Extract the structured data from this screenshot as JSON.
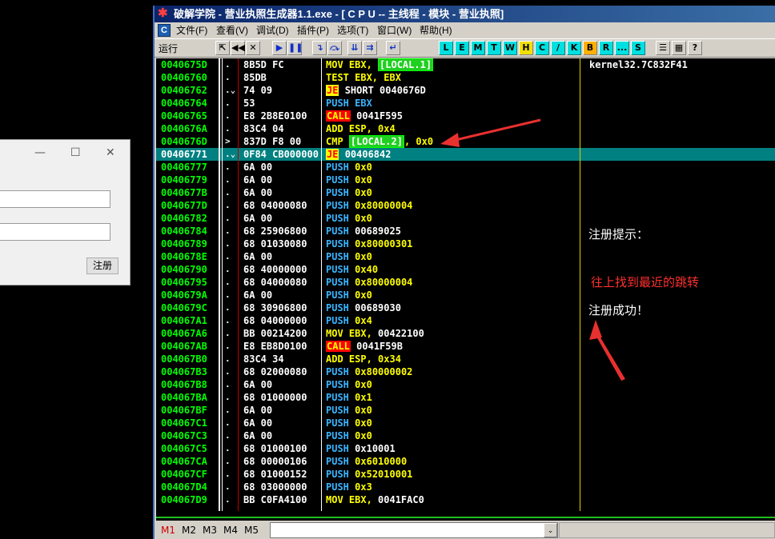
{
  "window": {
    "title": "破解学院 - 营业执照生成器1.1.exe - [ C P U -- 主线程 - 模块 - 营业执照]"
  },
  "menu": [
    "文件(F)",
    "查看(V)",
    "调试(D)",
    "插件(P)",
    "选项(T)",
    "窗口(W)",
    "帮助(H)"
  ],
  "toolbar": {
    "status": "运行",
    "letters": [
      "L",
      "E",
      "M",
      "T",
      "W",
      "H",
      "C",
      "/",
      "K",
      "B",
      "R",
      "...",
      "S"
    ]
  },
  "background_dialog": {
    "minimize": "—",
    "maximize": "☐",
    "close": "✕",
    "register_button": "注册"
  },
  "disasm": {
    "top_comment": "kernel32.7C832F41",
    "rows": [
      {
        "addr": "0040675D",
        "mark": ".",
        "hex": "8B5D FC",
        "mn": "MOV EBX,",
        "ops": [
          {
            "t": "LOCAL.1",
            "s": "grn"
          }
        ]
      },
      {
        "addr": "00406760",
        "mark": ".",
        "hex": "85DB",
        "mn": "TEST EBX, EBX",
        "ops": []
      },
      {
        "addr": "00406762",
        "mark": ".⌄",
        "hex": "74 09",
        "mn": "",
        "jmp": "JE",
        "ops": [
          {
            "t": "SHORT 0040676D",
            "s": "w"
          }
        ]
      },
      {
        "addr": "00406764",
        "mark": ".",
        "hex": "53",
        "mn": "PUSH EBX",
        "ops": []
      },
      {
        "addr": "00406765",
        "mark": ".",
        "hex": "E8 2B8E0100",
        "mn": "",
        "call": "CALL",
        "ops": [
          {
            "t": "0041F595",
            "s": "w"
          }
        ]
      },
      {
        "addr": "0040676A",
        "mark": ".",
        "hex": "83C4 04",
        "mn": "ADD ESP,",
        "ops": [
          {
            "t": "0x4",
            "s": "y"
          }
        ]
      },
      {
        "addr": "0040676D",
        "mark": ">",
        "hex": "837D F8 00",
        "mn": "CMP",
        "ops": [
          {
            "t": "LOCAL.2",
            "s": "grn"
          },
          {
            "t": ", 0x0",
            "s": "y"
          }
        ]
      },
      {
        "addr": "00406771",
        "mark": ".⌄",
        "hex": "0F84 CB000000",
        "mn": "",
        "jmp": "JE",
        "ops": [
          {
            "t": "00406842",
            "s": "w"
          }
        ],
        "selected": true
      },
      {
        "addr": "00406777",
        "mark": ".",
        "hex": "6A 00",
        "mn": "PUSH",
        "ops": [
          {
            "t": "0x0",
            "s": "y"
          }
        ]
      },
      {
        "addr": "00406779",
        "mark": ".",
        "hex": "6A 00",
        "mn": "PUSH",
        "ops": [
          {
            "t": "0x0",
            "s": "y"
          }
        ]
      },
      {
        "addr": "0040677B",
        "mark": ".",
        "hex": "6A 00",
        "mn": "PUSH",
        "ops": [
          {
            "t": "0x0",
            "s": "y"
          }
        ]
      },
      {
        "addr": "0040677D",
        "mark": ".",
        "hex": "68 04000080",
        "mn": "PUSH",
        "ops": [
          {
            "t": "0x80000004",
            "s": "y"
          }
        ]
      },
      {
        "addr": "00406782",
        "mark": ".",
        "hex": "6A 00",
        "mn": "PUSH",
        "ops": [
          {
            "t": "0x0",
            "s": "y"
          }
        ]
      },
      {
        "addr": "00406784",
        "mark": ".",
        "hex": "68 25906800",
        "mn": "PUSH",
        "ops": [
          {
            "t": "00689025",
            "s": "w"
          }
        ]
      },
      {
        "addr": "00406789",
        "mark": ".",
        "hex": "68 01030080",
        "mn": "PUSH",
        "ops": [
          {
            "t": "0x80000301",
            "s": "y"
          }
        ]
      },
      {
        "addr": "0040678E",
        "mark": ".",
        "hex": "6A 00",
        "mn": "PUSH",
        "ops": [
          {
            "t": "0x0",
            "s": "y"
          }
        ]
      },
      {
        "addr": "00406790",
        "mark": ".",
        "hex": "68 40000000",
        "mn": "PUSH",
        "ops": [
          {
            "t": "0x40",
            "s": "y"
          }
        ]
      },
      {
        "addr": "00406795",
        "mark": ".",
        "hex": "68 04000080",
        "mn": "PUSH",
        "ops": [
          {
            "t": "0x80000004",
            "s": "y"
          }
        ]
      },
      {
        "addr": "0040679A",
        "mark": ".",
        "hex": "6A 00",
        "mn": "PUSH",
        "ops": [
          {
            "t": "0x0",
            "s": "y"
          }
        ]
      },
      {
        "addr": "0040679C",
        "mark": ".",
        "hex": "68 30906800",
        "mn": "PUSH",
        "ops": [
          {
            "t": "00689030",
            "s": "w"
          }
        ]
      },
      {
        "addr": "004067A1",
        "mark": ".",
        "hex": "68 04000000",
        "mn": "PUSH",
        "ops": [
          {
            "t": "0x4",
            "s": "y"
          }
        ]
      },
      {
        "addr": "004067A6",
        "mark": ".",
        "hex": "BB 00214200",
        "mn": "MOV EBX,",
        "ops": [
          {
            "t": "00422100",
            "s": "w"
          }
        ]
      },
      {
        "addr": "004067AB",
        "mark": ".",
        "hex": "E8 EB8D0100",
        "mn": "",
        "call": "CALL",
        "ops": [
          {
            "t": "0041F59B",
            "s": "w"
          }
        ]
      },
      {
        "addr": "004067B0",
        "mark": ".",
        "hex": "83C4 34",
        "mn": "ADD ESP,",
        "ops": [
          {
            "t": "0x34",
            "s": "y"
          }
        ]
      },
      {
        "addr": "004067B3",
        "mark": ".",
        "hex": "68 02000080",
        "mn": "PUSH",
        "ops": [
          {
            "t": "0x80000002",
            "s": "y"
          }
        ]
      },
      {
        "addr": "004067B8",
        "mark": ".",
        "hex": "6A 00",
        "mn": "PUSH",
        "ops": [
          {
            "t": "0x0",
            "s": "y"
          }
        ]
      },
      {
        "addr": "004067BA",
        "mark": ".",
        "hex": "68 01000000",
        "mn": "PUSH",
        "ops": [
          {
            "t": "0x1",
            "s": "y"
          }
        ]
      },
      {
        "addr": "004067BF",
        "mark": ".",
        "hex": "6A 00",
        "mn": "PUSH",
        "ops": [
          {
            "t": "0x0",
            "s": "y"
          }
        ]
      },
      {
        "addr": "004067C1",
        "mark": ".",
        "hex": "6A 00",
        "mn": "PUSH",
        "ops": [
          {
            "t": "0x0",
            "s": "y"
          }
        ]
      },
      {
        "addr": "004067C3",
        "mark": ".",
        "hex": "6A 00",
        "mn": "PUSH",
        "ops": [
          {
            "t": "0x0",
            "s": "y"
          }
        ]
      },
      {
        "addr": "004067C5",
        "mark": ".",
        "hex": "68 01000100",
        "mn": "PUSH",
        "ops": [
          {
            "t": "0x10001",
            "s": "w"
          }
        ]
      },
      {
        "addr": "004067CA",
        "mark": ".",
        "hex": "68 00000106",
        "mn": "PUSH",
        "ops": [
          {
            "t": "0x6010000",
            "s": "y"
          }
        ]
      },
      {
        "addr": "004067CF",
        "mark": ".",
        "hex": "68 01000152",
        "mn": "PUSH",
        "ops": [
          {
            "t": "0x52010001",
            "s": "y"
          }
        ]
      },
      {
        "addr": "004067D4",
        "mark": ".",
        "hex": "68 03000000",
        "mn": "PUSH",
        "ops": [
          {
            "t": "0x3",
            "s": "y"
          }
        ]
      },
      {
        "addr": "004067D9",
        "mark": ".",
        "hex": "BB C0FA4100",
        "mn": "MOV EBX,",
        "ops": [
          {
            "t": "0041FAC0",
            "s": "w"
          }
        ]
      }
    ]
  },
  "annotations": {
    "reg_hint": "注册提示：",
    "red_note": "往上找到最近的跳转",
    "reg_success": "注册成功！"
  },
  "bottom": {
    "tabs": [
      "M1",
      "M2",
      "M3",
      "M4",
      "M5"
    ],
    "dropdown": "⌄"
  },
  "colors": {
    "address": "#00ff00",
    "selected_row": "#008080",
    "arrow": "#e8302f",
    "note_red": "#ff3030"
  }
}
